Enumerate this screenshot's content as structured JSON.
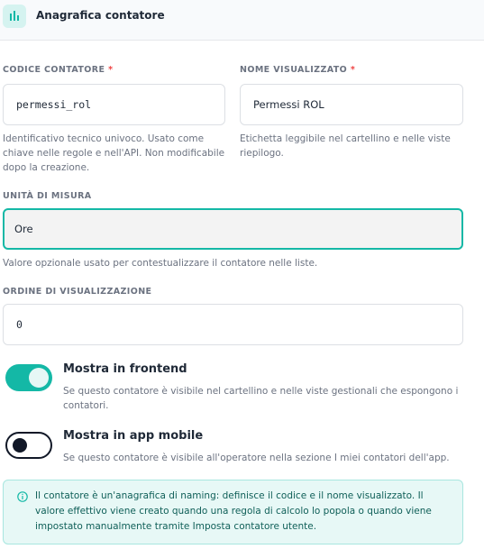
{
  "header": {
    "title": "Anagrafica contatore",
    "icon": "bar-chart-icon",
    "accent": "#14b8a6"
  },
  "fields": {
    "codice": {
      "label": "CODICE CONTATORE",
      "required_mark": "*",
      "value": "permessi_rol",
      "help": "Identificativo tecnico univoco. Usato come chiave nelle regole e nell'API. Non modificabile dopo la creazione."
    },
    "nome": {
      "label": "NOME VISUALIZZATO",
      "required_mark": "*",
      "value": "Permessi ROL",
      "help": "Etichetta leggibile nel cartellino e nelle viste riepilogo."
    },
    "unita": {
      "label": "UNITÀ DI MISURA",
      "value": "Ore",
      "help": "Valore opzionale usato per contestualizzare il contatore nelle liste."
    },
    "ordine": {
      "label": "ORDINE DI VISUALIZZAZIONE",
      "value": "0"
    }
  },
  "toggles": {
    "frontend": {
      "title": "Mostra in frontend",
      "desc": "Se questo contatore è visibile nel cartellino e nelle viste gestionali che espongono i contatori.",
      "checked": true
    },
    "mobile": {
      "title": "Mostra in app mobile",
      "desc": "Se questo contatore è visibile all'operatore nella sezione I miei contatori dell'app.",
      "checked": false
    }
  },
  "info": {
    "icon": "info-icon",
    "text": "Il contatore è un'anagrafica di naming: definisce il codice e il nome visualizzato. Il valore effettivo viene creato quando una regola di calcolo lo popola o quando viene impostato manualmente tramite Imposta contatore utente."
  }
}
